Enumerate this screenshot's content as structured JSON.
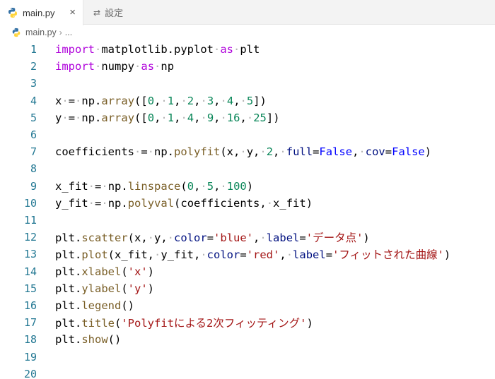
{
  "tabs": [
    {
      "label": "main.py",
      "close_glyph": "×",
      "icon": "python-icon"
    },
    {
      "label": "設定",
      "icon": "settings-icon"
    }
  ],
  "breadcrumb": {
    "file": "main.py",
    "separator": "›",
    "rest": "..."
  },
  "lines": [
    {
      "n": "1",
      "tokens": [
        [
          "kw",
          "import"
        ],
        [
          "ws",
          "·"
        ],
        [
          "p",
          "matplotlib.pyplot"
        ],
        [
          "ws",
          "·"
        ],
        [
          "kw",
          "as"
        ],
        [
          "ws",
          "·"
        ],
        [
          "p",
          "plt"
        ]
      ]
    },
    {
      "n": "2",
      "tokens": [
        [
          "kw",
          "import"
        ],
        [
          "ws",
          "·"
        ],
        [
          "p",
          "numpy"
        ],
        [
          "ws",
          "·"
        ],
        [
          "kw",
          "as"
        ],
        [
          "ws",
          "·"
        ],
        [
          "p",
          "np"
        ]
      ]
    },
    {
      "n": "3",
      "tokens": []
    },
    {
      "n": "4",
      "tokens": [
        [
          "p",
          "x"
        ],
        [
          "ws",
          "·"
        ],
        [
          "p",
          "="
        ],
        [
          "ws",
          "·"
        ],
        [
          "p",
          "np."
        ],
        [
          "fn",
          "array"
        ],
        [
          "p",
          "(["
        ],
        [
          "num",
          "0"
        ],
        [
          "p",
          ","
        ],
        [
          "ws",
          "·"
        ],
        [
          "num",
          "1"
        ],
        [
          "p",
          ","
        ],
        [
          "ws",
          "·"
        ],
        [
          "num",
          "2"
        ],
        [
          "p",
          ","
        ],
        [
          "ws",
          "·"
        ],
        [
          "num",
          "3"
        ],
        [
          "p",
          ","
        ],
        [
          "ws",
          "·"
        ],
        [
          "num",
          "4"
        ],
        [
          "p",
          ","
        ],
        [
          "ws",
          "·"
        ],
        [
          "num",
          "5"
        ],
        [
          "p",
          "])"
        ]
      ]
    },
    {
      "n": "5",
      "tokens": [
        [
          "p",
          "y"
        ],
        [
          "ws",
          "·"
        ],
        [
          "p",
          "="
        ],
        [
          "ws",
          "·"
        ],
        [
          "p",
          "np."
        ],
        [
          "fn",
          "array"
        ],
        [
          "p",
          "(["
        ],
        [
          "num",
          "0"
        ],
        [
          "p",
          ","
        ],
        [
          "ws",
          "·"
        ],
        [
          "num",
          "1"
        ],
        [
          "p",
          ","
        ],
        [
          "ws",
          "·"
        ],
        [
          "num",
          "4"
        ],
        [
          "p",
          ","
        ],
        [
          "ws",
          "·"
        ],
        [
          "num",
          "9"
        ],
        [
          "p",
          ","
        ],
        [
          "ws",
          "·"
        ],
        [
          "num",
          "16"
        ],
        [
          "p",
          ","
        ],
        [
          "ws",
          "·"
        ],
        [
          "num",
          "25"
        ],
        [
          "p",
          "])"
        ]
      ]
    },
    {
      "n": "6",
      "tokens": []
    },
    {
      "n": "7",
      "tokens": [
        [
          "p",
          "coefficients"
        ],
        [
          "ws",
          "·"
        ],
        [
          "p",
          "="
        ],
        [
          "ws",
          "·"
        ],
        [
          "p",
          "np."
        ],
        [
          "fn",
          "polyfit"
        ],
        [
          "p",
          "(x,"
        ],
        [
          "ws",
          "·"
        ],
        [
          "p",
          "y,"
        ],
        [
          "ws",
          "·"
        ],
        [
          "num",
          "2"
        ],
        [
          "p",
          ","
        ],
        [
          "ws",
          "·"
        ],
        [
          "var",
          "full"
        ],
        [
          "p",
          "="
        ],
        [
          "const",
          "False"
        ],
        [
          "p",
          ","
        ],
        [
          "ws",
          "·"
        ],
        [
          "var",
          "cov"
        ],
        [
          "p",
          "="
        ],
        [
          "const",
          "False"
        ],
        [
          "p",
          ")"
        ]
      ]
    },
    {
      "n": "8",
      "tokens": []
    },
    {
      "n": "9",
      "tokens": [
        [
          "p",
          "x_fit"
        ],
        [
          "ws",
          "·"
        ],
        [
          "p",
          "="
        ],
        [
          "ws",
          "·"
        ],
        [
          "p",
          "np."
        ],
        [
          "fn",
          "linspace"
        ],
        [
          "p",
          "("
        ],
        [
          "num",
          "0"
        ],
        [
          "p",
          ","
        ],
        [
          "ws",
          "·"
        ],
        [
          "num",
          "5"
        ],
        [
          "p",
          ","
        ],
        [
          "ws",
          "·"
        ],
        [
          "num",
          "100"
        ],
        [
          "p",
          ")"
        ]
      ]
    },
    {
      "n": "10",
      "tokens": [
        [
          "p",
          "y_fit"
        ],
        [
          "ws",
          "·"
        ],
        [
          "p",
          "="
        ],
        [
          "ws",
          "·"
        ],
        [
          "p",
          "np."
        ],
        [
          "fn",
          "polyval"
        ],
        [
          "p",
          "(coefficients,"
        ],
        [
          "ws",
          "·"
        ],
        [
          "p",
          "x_fit)"
        ]
      ]
    },
    {
      "n": "11",
      "tokens": []
    },
    {
      "n": "12",
      "tokens": [
        [
          "p",
          "plt."
        ],
        [
          "fn",
          "scatter"
        ],
        [
          "p",
          "(x,"
        ],
        [
          "ws",
          "·"
        ],
        [
          "p",
          "y,"
        ],
        [
          "ws",
          "·"
        ],
        [
          "var",
          "color"
        ],
        [
          "p",
          "="
        ],
        [
          "str",
          "'blue'"
        ],
        [
          "p",
          ","
        ],
        [
          "ws",
          "·"
        ],
        [
          "var",
          "label"
        ],
        [
          "p",
          "="
        ],
        [
          "str",
          "'データ点'"
        ],
        [
          "p",
          ")"
        ]
      ]
    },
    {
      "n": "13",
      "tokens": [
        [
          "p",
          "plt."
        ],
        [
          "fn",
          "plot"
        ],
        [
          "p",
          "(x_fit,"
        ],
        [
          "ws",
          "·"
        ],
        [
          "p",
          "y_fit,"
        ],
        [
          "ws",
          "·"
        ],
        [
          "var",
          "color"
        ],
        [
          "p",
          "="
        ],
        [
          "str",
          "'red'"
        ],
        [
          "p",
          ","
        ],
        [
          "ws",
          "·"
        ],
        [
          "var",
          "label"
        ],
        [
          "p",
          "="
        ],
        [
          "str",
          "'フィットされた曲線'"
        ],
        [
          "p",
          ")"
        ]
      ]
    },
    {
      "n": "14",
      "tokens": [
        [
          "p",
          "plt."
        ],
        [
          "fn",
          "xlabel"
        ],
        [
          "p",
          "("
        ],
        [
          "str",
          "'x'"
        ],
        [
          "p",
          ")"
        ]
      ]
    },
    {
      "n": "15",
      "tokens": [
        [
          "p",
          "plt."
        ],
        [
          "fn",
          "ylabel"
        ],
        [
          "p",
          "("
        ],
        [
          "str",
          "'y'"
        ],
        [
          "p",
          ")"
        ]
      ]
    },
    {
      "n": "16",
      "tokens": [
        [
          "p",
          "plt."
        ],
        [
          "fn",
          "legend"
        ],
        [
          "p",
          "()"
        ]
      ]
    },
    {
      "n": "17",
      "tokens": [
        [
          "p",
          "plt."
        ],
        [
          "fn",
          "title"
        ],
        [
          "p",
          "("
        ],
        [
          "str",
          "'Polyfitによる2次フィッティング'"
        ],
        [
          "p",
          ")"
        ]
      ]
    },
    {
      "n": "18",
      "tokens": [
        [
          "p",
          "plt."
        ],
        [
          "fn",
          "show"
        ],
        [
          "p",
          "()"
        ]
      ]
    },
    {
      "n": "19",
      "tokens": []
    },
    {
      "n": "20",
      "tokens": []
    }
  ],
  "colors": {
    "keyword": "#af00db",
    "function": "#795e26",
    "number": "#098658",
    "string": "#a31515",
    "constant": "#0000ff",
    "parameter": "#001080",
    "line_number": "#237893"
  }
}
